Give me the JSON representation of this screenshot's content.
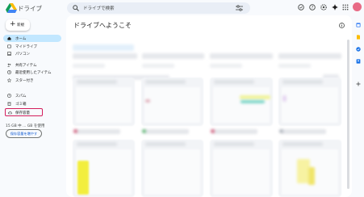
{
  "app": {
    "title": "ドライブ"
  },
  "search": {
    "placeholder": "ドライブで検索"
  },
  "header_icons": [
    "offline-status-icon",
    "help-icon",
    "settings-icon",
    "gemini-spark-icon",
    "apps-grid-icon"
  ],
  "sidebar": {
    "new_label": "新規",
    "items": [
      {
        "label": "ホーム",
        "icon": "home-icon"
      },
      {
        "label": "マイドライブ",
        "icon": "my-drive-icon"
      },
      {
        "label": "パソコン",
        "icon": "computer-icon"
      },
      {
        "label": "共有アイテム",
        "icon": "shared-icon"
      },
      {
        "label": "最近使用したアイテム",
        "icon": "recent-icon"
      },
      {
        "label": "スター付き",
        "icon": "star-icon"
      },
      {
        "label": "スパム",
        "icon": "spam-icon"
      },
      {
        "label": "ゴミ箱",
        "icon": "trash-icon"
      },
      {
        "label": "保存容量",
        "icon": "cloud-icon"
      }
    ],
    "storage_text": "15 GB 中 ... GB を使用",
    "storage_button": "保存容量を増やす"
  },
  "main": {
    "welcome": "ドライブへようこそ"
  },
  "colors": {
    "active_bg": "#c2e7ff",
    "highlight_border": "#d41e5d",
    "search_bg": "#e9eef6",
    "accent": "#0b57d0"
  }
}
